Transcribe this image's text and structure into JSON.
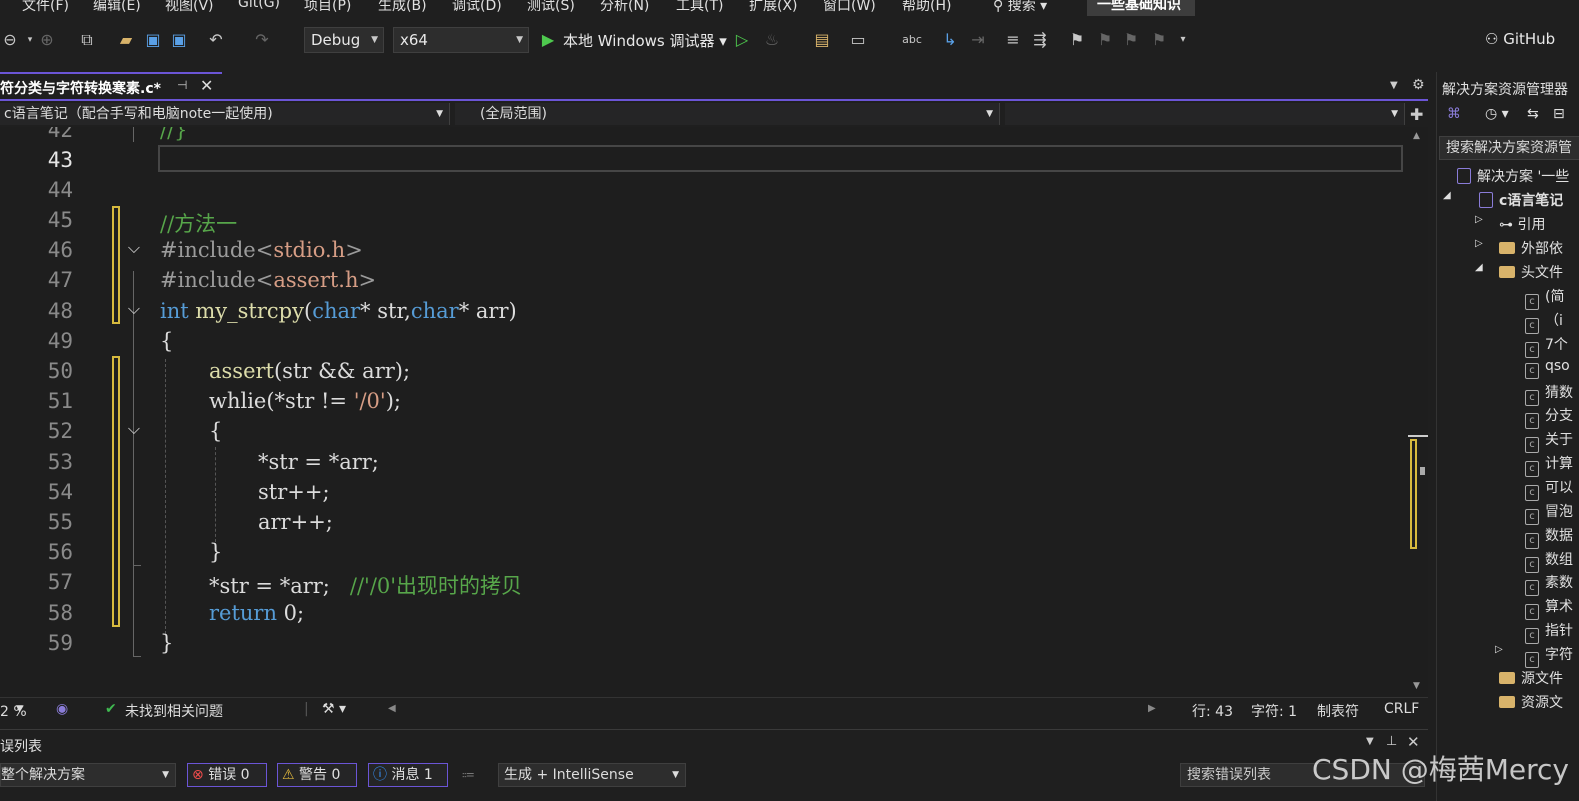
{
  "menu": {
    "items": [
      "文件(F)",
      "编辑(E)",
      "视图(V)",
      "Git(G)",
      "项目(P)",
      "生成(B)",
      "调试(D)",
      "测试(S)",
      "分析(N)",
      "工具(T)",
      "扩展(X)",
      "窗口(W)",
      "帮助(H)"
    ],
    "search": "搜索",
    "active_solution": "一些基础知识"
  },
  "toolbar": {
    "config": "Debug",
    "platform": "x64",
    "debugger": "本地 Windows 调试器",
    "github": "GitHub"
  },
  "tab": {
    "name": "符分类与字符转换寒素.c*"
  },
  "navbar": {
    "project": "c语言笔记（配合手写和电脑note一起使用)",
    "scope": "(全局范围)"
  },
  "editor": {
    "current_line": 43,
    "lines": [
      {
        "n": "42",
        "text": "//}"
      },
      {
        "n": "43",
        "text": ""
      },
      {
        "n": "44",
        "text": ""
      },
      {
        "n": "45",
        "text": "//方法一"
      },
      {
        "n": "46",
        "text": "#include<stdio.h>"
      },
      {
        "n": "47",
        "text": "#include<assert.h>"
      },
      {
        "n": "48",
        "text": "int my_strcpy(char* str,char* arr)"
      },
      {
        "n": "49",
        "text": "{"
      },
      {
        "n": "50",
        "text": "assert(str && arr);"
      },
      {
        "n": "51",
        "text": "whlie(*str != '/0');"
      },
      {
        "n": "52",
        "text": "{"
      },
      {
        "n": "53",
        "text": "*str = *arr;"
      },
      {
        "n": "54",
        "text": "str++;"
      },
      {
        "n": "55",
        "text": "arr++;"
      },
      {
        "n": "56",
        "text": "}"
      },
      {
        "n": "57",
        "text": "*str = *arr;   //'/0'出现时的拷贝"
      },
      {
        "n": "58",
        "text": "return 0;"
      },
      {
        "n": "59",
        "text": "}"
      }
    ]
  },
  "status": {
    "zoom": "2 %",
    "issues": "未找到相关问题",
    "line": "行: 43",
    "char": "字符: 1",
    "tabs": "制表符",
    "eol": "CRLF"
  },
  "errorlist": {
    "title": "误列表",
    "scope": "整个解决方案",
    "errors": "错误 0",
    "warnings": "警告 0",
    "messages": "消息 1",
    "build": "生成 + IntelliSense",
    "search": "搜索错误列表"
  },
  "solution_explorer": {
    "title": "解决方案资源管理器",
    "search": "搜索解决方案资源管",
    "solution": "解决方案 '一些",
    "project": "c语言笔记",
    "refs": "引用",
    "external": "外部依",
    "headers": "头文件",
    "files": [
      "(简",
      "（i",
      "7个",
      "qso",
      "猜数",
      "分支",
      "关于",
      "计算",
      "可以",
      "冒泡",
      "数据",
      "数组",
      "素数",
      "算术",
      "指针",
      "字符"
    ],
    "sources": "源文件",
    "resources": "资源文"
  },
  "watermark": "CSDN @梅茜Mercy",
  "colors": {
    "accent": "#6b55d6",
    "change_marker": "#d7ba3e",
    "keyword": "#569cd6",
    "comment": "#57a64a",
    "string": "#d69d85"
  }
}
